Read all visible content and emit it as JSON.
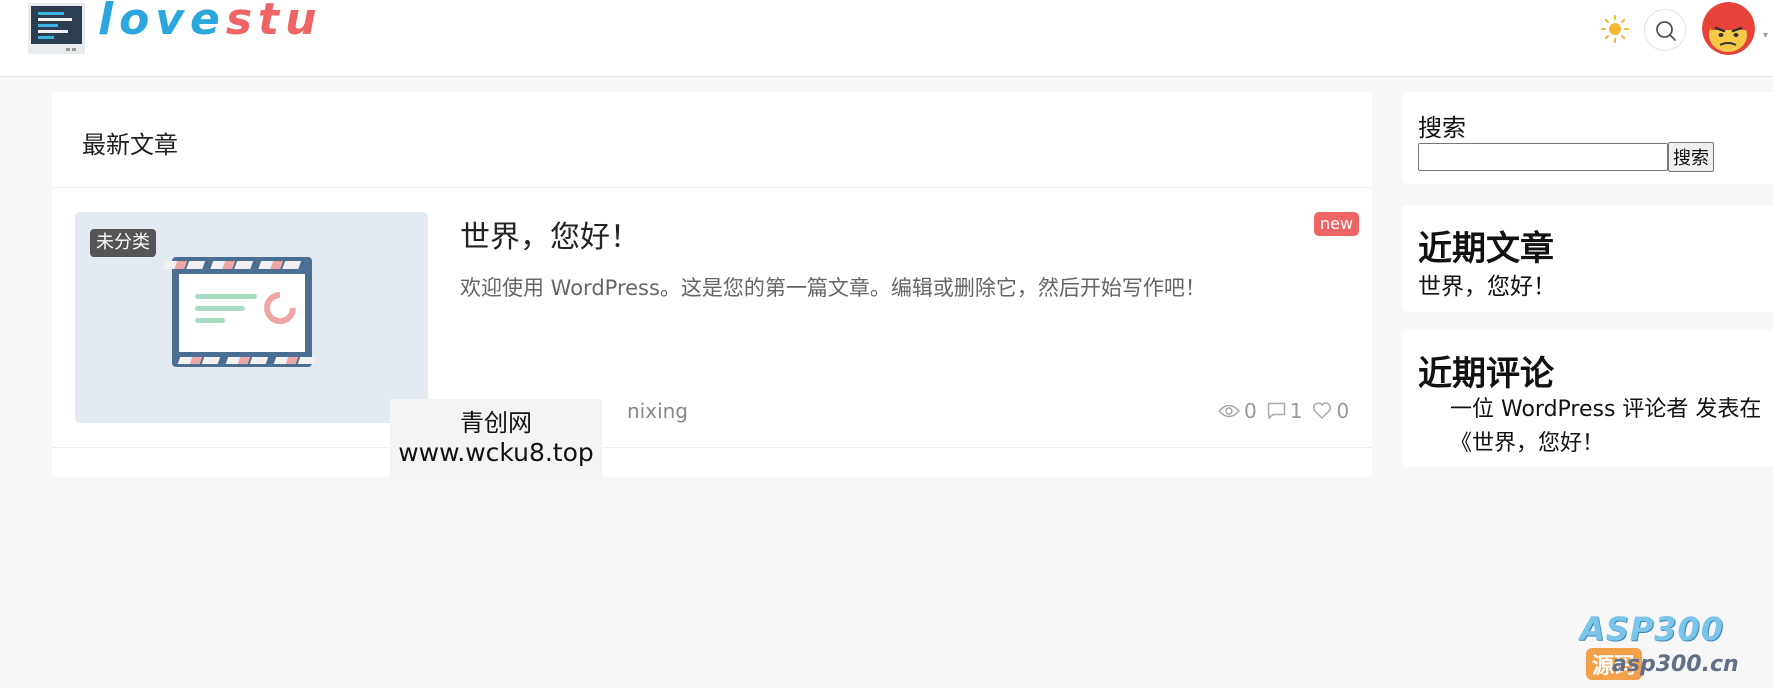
{
  "header": {
    "logo_part1": "love",
    "logo_part2": "stu"
  },
  "icons": {
    "theme": "sun-icon",
    "search": "search-icon",
    "avatar": "avatar"
  },
  "colors": {
    "logo_blue": "#2ba7de",
    "logo_red": "#ef6464",
    "badge_new": "#ef6464",
    "category_badge": "#555555"
  },
  "main": {
    "section_title": "最新文章",
    "post": {
      "category": "未分类",
      "title": "世界，您好！",
      "badge": "new",
      "excerpt": "欢迎使用 WordPress。这是您的第一篇文章。编辑或删除它，然后开始写作吧！",
      "author": "nixing",
      "views": "0",
      "comments": "1",
      "likes": "0"
    }
  },
  "watermark": {
    "line1": "青创网",
    "line2": "www.wcku8.top"
  },
  "sidebar": {
    "search": {
      "label": "搜索",
      "input_value": "",
      "button": "搜索"
    },
    "recent_posts": {
      "title": "近期文章",
      "items": [
        "世界，您好！"
      ]
    },
    "recent_comments": {
      "title": "近期评论",
      "author": "一位 WordPress 评论者",
      "middle": " 发表在《",
      "post": "世界，您好！"
    }
  },
  "site_watermark": {
    "brand": "ASP300",
    "tag": "源码",
    "url": "asp300.cn"
  }
}
